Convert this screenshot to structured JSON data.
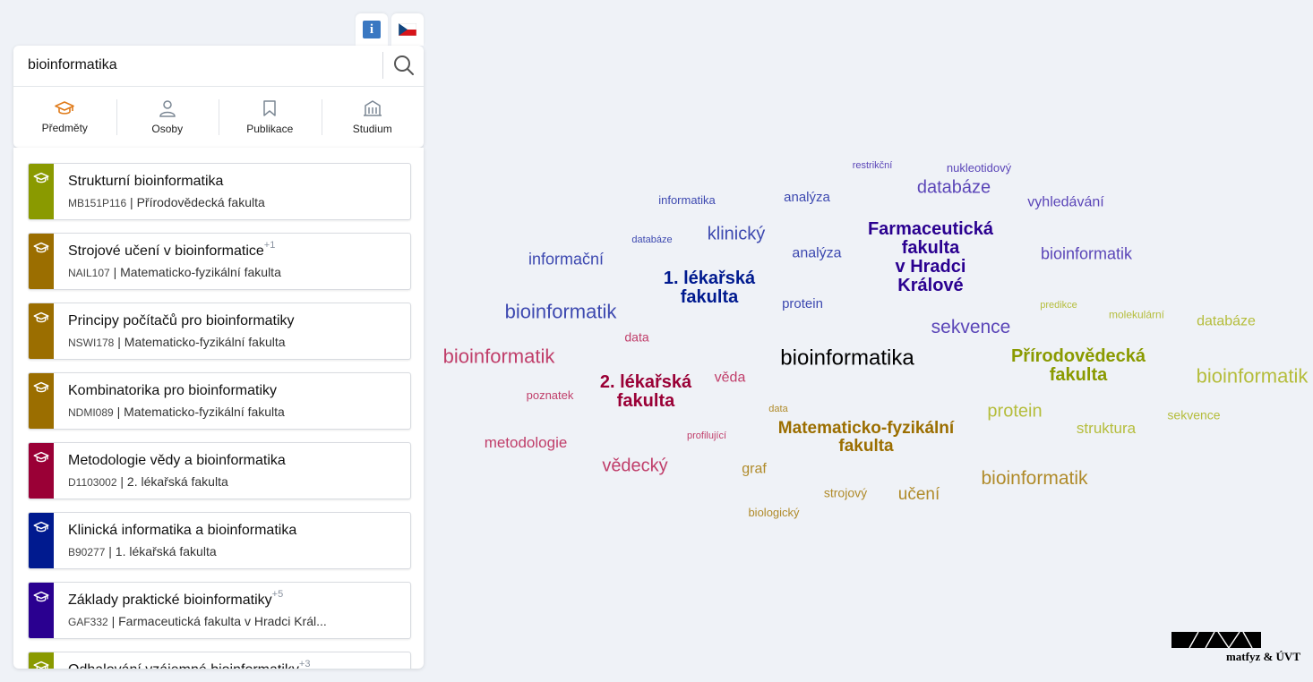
{
  "search": {
    "value": "bioinformatika"
  },
  "tabs": [
    {
      "label": "Předměty",
      "icon": "graduation-cap-icon",
      "active": true
    },
    {
      "label": "Osoby",
      "icon": "person-icon",
      "active": false
    },
    {
      "label": "Publikace",
      "icon": "bookmark-icon",
      "active": false
    },
    {
      "label": "Studium",
      "icon": "building-icon",
      "active": false
    }
  ],
  "colors": {
    "accent": "#e07b1a",
    "prf": "#8a9a00",
    "mff": "#9b6e00",
    "lf2": "#9a0036",
    "lf1": "#001a8f",
    "faf": "#2a0090"
  },
  "results": [
    {
      "title": "Strukturní bioinformatika",
      "badge": "",
      "code": "MB151P116",
      "faculty": "Přírodovědecká fakulta",
      "color": "#8a9a00"
    },
    {
      "title": "Strojové učení v bioinformatice",
      "badge": "+1",
      "code": "NAIL107",
      "faculty": "Matematicko-fyzikální fakulta",
      "color": "#9b6e00"
    },
    {
      "title": "Principy počítačů pro bioinformatiky",
      "badge": "",
      "code": "NSWI178",
      "faculty": "Matematicko-fyzikální fakulta",
      "color": "#9b6e00"
    },
    {
      "title": "Kombinatorika pro bioinformatiky",
      "badge": "",
      "code": "NDMI089",
      "faculty": "Matematicko-fyzikální fakulta",
      "color": "#9b6e00"
    },
    {
      "title": "Metodologie vědy a bioinformatika",
      "badge": "",
      "code": "D1103002",
      "faculty": "2. lékařská fakulta",
      "color": "#9a0036"
    },
    {
      "title": "Klinická informatika a bioinformatika",
      "badge": "",
      "code": "B90277",
      "faculty": "1. lékařská fakulta",
      "color": "#001a8f"
    },
    {
      "title": "Základy praktické bioinformatiky",
      "badge": "+5",
      "code": "GAF332",
      "faculty": "Farmaceutická fakulta v Hradci Král...",
      "color": "#2a0090"
    },
    {
      "title": "Odhalování vzájemné bioinformatiky",
      "badge": "+3",
      "code": "",
      "faculty": "",
      "color": "#8a9a00"
    }
  ],
  "wordcloud": [
    {
      "text": "restrikční",
      "color": "#5b46b8"
    },
    {
      "text": "nukleotidový",
      "color": "#5b46b8"
    },
    {
      "text": "databáze",
      "color": "#5b46b8"
    },
    {
      "text": "informatika",
      "color": "#3d49b0"
    },
    {
      "text": "analýza",
      "color": "#3d49b0"
    },
    {
      "text": "vyhledávání",
      "color": "#5b46b8"
    },
    {
      "text": "Farmaceutická fakulta v Hradci Králové",
      "color": "#2a0090"
    },
    {
      "text": "databáze",
      "color": "#3d49b0"
    },
    {
      "text": "klinický",
      "color": "#3d49b0"
    },
    {
      "text": "informační",
      "color": "#3d49b0"
    },
    {
      "text": "analýza",
      "color": "#3d49b0"
    },
    {
      "text": "bioinformatik",
      "color": "#5b46b8"
    },
    {
      "text": "1. lékařská fakulta",
      "color": "#001a8f"
    },
    {
      "text": "protein",
      "color": "#3d49b0"
    },
    {
      "text": "bioinformatik",
      "color": "#3d49b0"
    },
    {
      "text": "predikce",
      "color": "#b5bd3c"
    },
    {
      "text": "molekulární",
      "color": "#b5bd3c"
    },
    {
      "text": "databáze",
      "color": "#b5bd3c"
    },
    {
      "text": "sekvence",
      "color": "#5b46b8"
    },
    {
      "text": "data",
      "color": "#c03e6a"
    },
    {
      "text": "bioinformatik",
      "color": "#c03e6a"
    },
    {
      "text": "bioinformatika",
      "color": "#000000"
    },
    {
      "text": "Přírodovědecká fakulta",
      "color": "#8a9a00"
    },
    {
      "text": "bioinformatik",
      "color": "#b5bd3c"
    },
    {
      "text": "2. lékařská fakulta",
      "color": "#9a0036"
    },
    {
      "text": "věda",
      "color": "#c03e6a"
    },
    {
      "text": "poznatek",
      "color": "#c03e6a"
    },
    {
      "text": "data",
      "color": "#b08b2a"
    },
    {
      "text": "protein",
      "color": "#b5bd3c"
    },
    {
      "text": "sekvence",
      "color": "#b5bd3c"
    },
    {
      "text": "Matematicko-fyzikální fakulta",
      "color": "#9b6e00"
    },
    {
      "text": "struktura",
      "color": "#b5bd3c"
    },
    {
      "text": "profilující",
      "color": "#c03e6a"
    },
    {
      "text": "metodologie",
      "color": "#c03e6a"
    },
    {
      "text": "vědecký",
      "color": "#c03e6a"
    },
    {
      "text": "graf",
      "color": "#b08b2a"
    },
    {
      "text": "bioinformatik",
      "color": "#b08b2a"
    },
    {
      "text": "strojový",
      "color": "#b08b2a"
    },
    {
      "text": "učení",
      "color": "#b08b2a"
    },
    {
      "text": "biologický",
      "color": "#b08b2a"
    }
  ],
  "logo": {
    "text": "matfyz & ÚVT"
  }
}
